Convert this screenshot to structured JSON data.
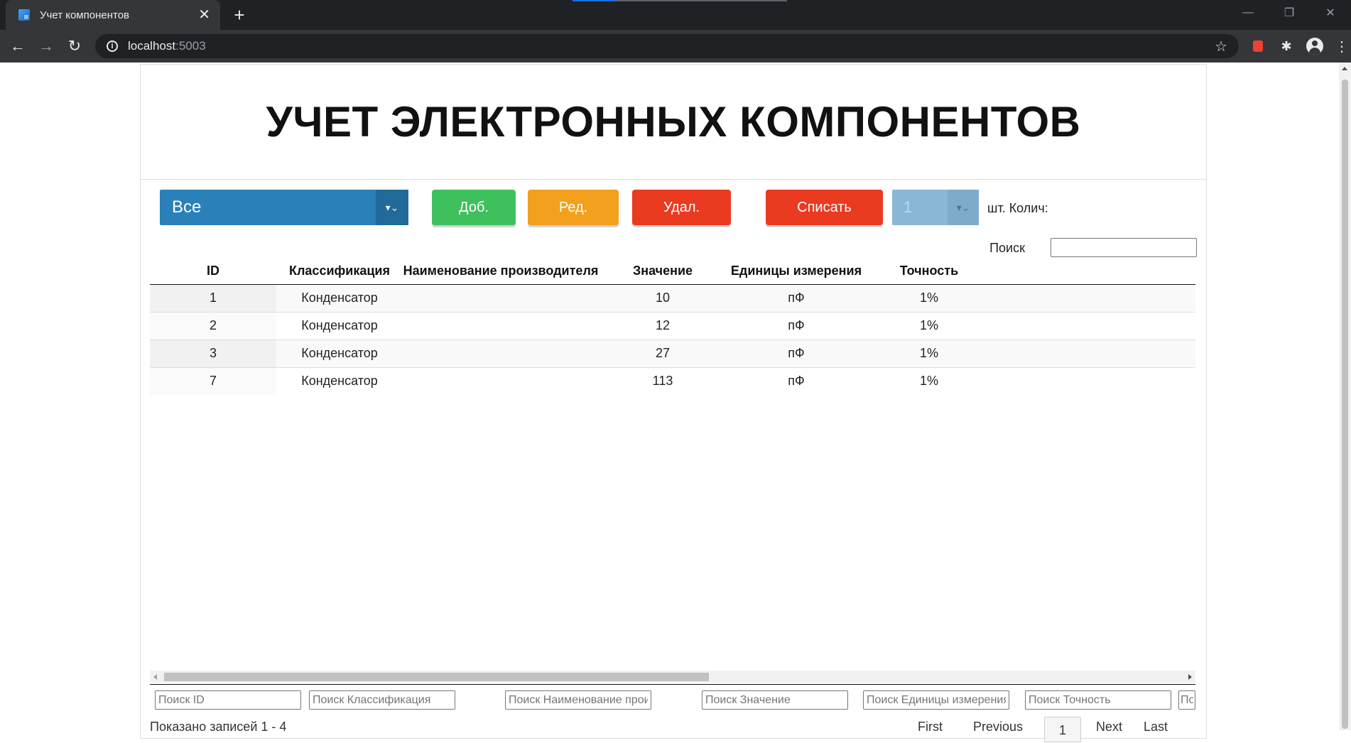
{
  "browser": {
    "tab_title": "Учет компонентов",
    "tab_close": "✕",
    "new_tab": "+",
    "url_host": "localhost",
    "url_port": ":5003",
    "back": "←",
    "forward": "→",
    "reload": "↻",
    "star": "☆",
    "window_controls": [
      "—",
      "❐",
      "✕"
    ],
    "info_icon": "i",
    "puzzle_icon": "✱"
  },
  "page": {
    "title": "УЧЕТ ЭЛЕКТРОННЫХ КОМПОНЕНТОВ"
  },
  "controls": {
    "category_select": "Все",
    "add_label": "Доб.",
    "edit_label": "Ред.",
    "delete_label": "Удал.",
    "writeoff_label": "Списать",
    "qty_value": "1",
    "qty_label": "шт. Колич:",
    "select_arrow": "▾⌄"
  },
  "search": {
    "label": "Поиск",
    "value": ""
  },
  "table": {
    "columns": [
      "ID",
      "Классификация",
      "Наименование производителя",
      "Значение",
      "Единицы измерения",
      "Точность"
    ],
    "rows": [
      [
        "1",
        "Конденсатор",
        "",
        "10",
        "пФ",
        "1%"
      ],
      [
        "2",
        "Конденсатор",
        "",
        "12",
        "пФ",
        "1%"
      ],
      [
        "3",
        "Конденсатор",
        "",
        "27",
        "пФ",
        "1%"
      ],
      [
        "7",
        "Конденсатор",
        "",
        "113",
        "пФ",
        "1%"
      ]
    ]
  },
  "column_search_placeholders": [
    "Поиск ID",
    "Поиск Классификация",
    "Поиск Наименование производителя",
    "Поиск Значение",
    "Поиск Единицы измерения",
    "Поиск Точность",
    "По"
  ],
  "footer": {
    "info": "Показано записей 1 - 4",
    "first": "First",
    "previous": "Previous",
    "page": "1",
    "next": "Next",
    "last": "Last"
  }
}
